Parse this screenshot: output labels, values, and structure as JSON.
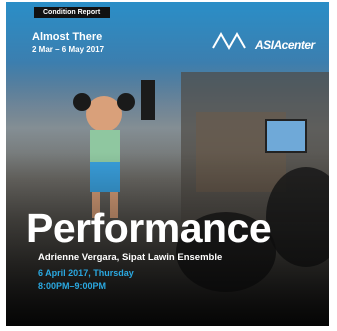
{
  "header": {
    "tag": "Condition Report",
    "exhibition_title": "Almost There",
    "exhibition_dates": "2 Mar – 6 May 2017"
  },
  "logos": {
    "org": "ASIAcenter"
  },
  "event": {
    "type": "Performance",
    "artists": "Adrienne Vergara, Sipat Lawin Ensemble",
    "date": "6 April 2017, Thursday",
    "time": "8:00PM–9:00PM"
  },
  "colors": {
    "accent": "#2aa8e0",
    "tag_bg": "#111111"
  }
}
